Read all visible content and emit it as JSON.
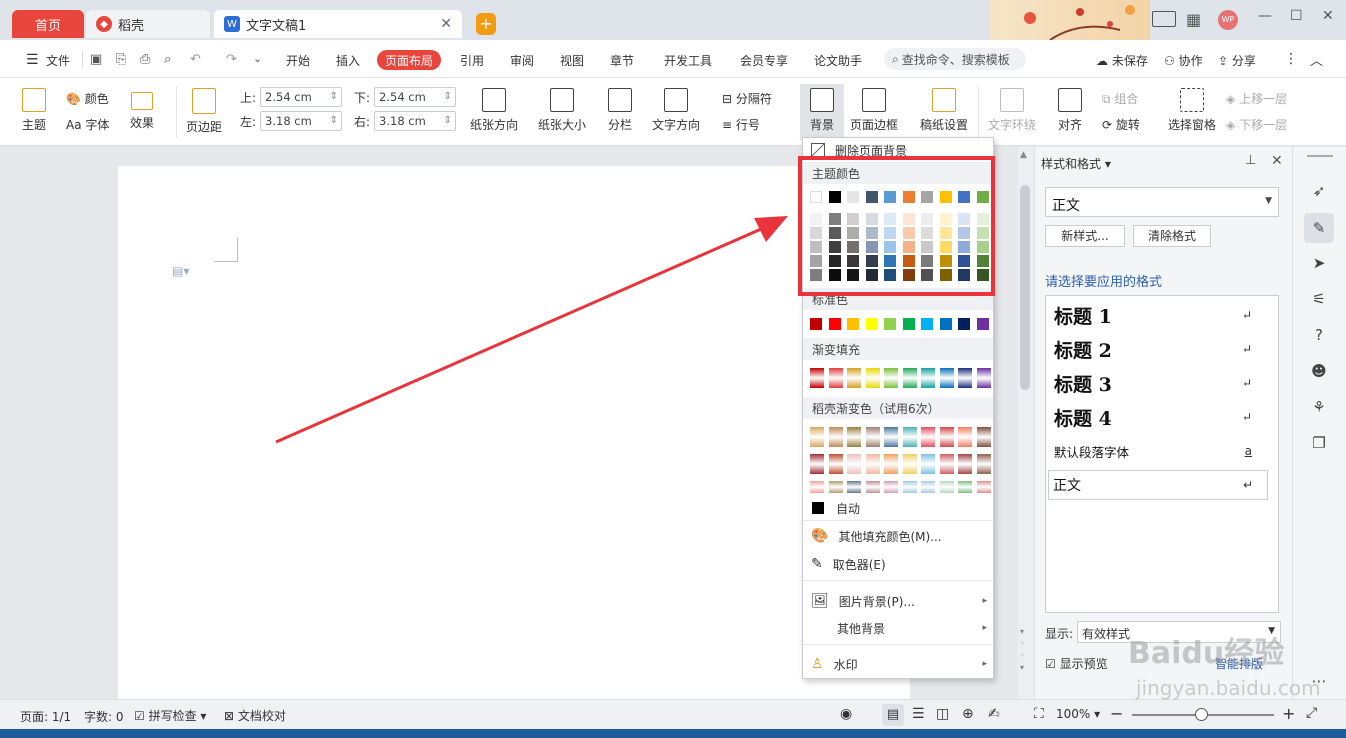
{
  "tabs": {
    "home": "首页",
    "daoke": "稻壳",
    "doc": "文字文稿1"
  },
  "menu": {
    "file": "文件",
    "items": [
      "开始",
      "插入",
      "页面布局",
      "引用",
      "审阅",
      "视图",
      "章节",
      "开发工具",
      "会员专享",
      "论文助手"
    ],
    "active_index": 2,
    "search": "查找命令、搜索模板",
    "unsaved": "未保存",
    "collab": "协作",
    "share": "分享"
  },
  "ribbon": {
    "theme": "主题",
    "color": "颜色",
    "font": "字体",
    "effect": "效果",
    "margins": "页边距",
    "top_label": "上:",
    "top_val": "2.54 cm",
    "bottom_label": "下:",
    "bottom_val": "2.54 cm",
    "left_label": "左:",
    "left_val": "3.18 cm",
    "right_label": "右:",
    "right_val": "3.18 cm",
    "orientation": "纸张方向",
    "size": "纸张大小",
    "columns": "分栏",
    "textdir": "文字方向",
    "breaks": "分隔符",
    "linenum": "行号",
    "background": "背景",
    "border": "页面边框",
    "grid": "稿纸设置",
    "wrap": "文字环绕",
    "align": "对齐",
    "group": "组合",
    "rotate": "旋转",
    "selpane": "选择窗格",
    "up": "上移一层",
    "down": "下移一层"
  },
  "dropdown": {
    "remove_bg": "删除页面背景",
    "theme_colors": "主题颜色",
    "std_colors": "标准色",
    "gradient": "渐变填充",
    "daoke_gradient": "稻壳渐变色（试用6次）",
    "auto": "自动",
    "more_colors": "其他填充颜色(M)...",
    "picker": "取色器(E)",
    "pic_bg": "图片背景(P)...",
    "other_bg": "其他背景",
    "watermark": "水印"
  },
  "colors": {
    "theme_row": [
      "#ffffff",
      "#000000",
      "#e7e6e6",
      "#44546a",
      "#5b9bd5",
      "#ed7d31",
      "#a5a5a5",
      "#ffc000",
      "#4472c4",
      "#70ad47"
    ],
    "theme_shades": [
      [
        "#f2f2f2",
        "#7f7f7f",
        "#d0cece",
        "#d6dce4",
        "#deebf6",
        "#fbe5d5",
        "#ededed",
        "#fff2cc",
        "#dae3f3",
        "#e2efd9"
      ],
      [
        "#d8d8d8",
        "#595959",
        "#aeabab",
        "#adb9ca",
        "#bdd7ee",
        "#f7cbac",
        "#dbdbdb",
        "#fee599",
        "#b4c6e7",
        "#c5e0b3"
      ],
      [
        "#bfbfbf",
        "#3f3f3f",
        "#757070",
        "#8496b0",
        "#9dc3e6",
        "#f4b183",
        "#c9c9c9",
        "#ffd966",
        "#8eaadb",
        "#a8d08d"
      ],
      [
        "#a5a5a5",
        "#262626",
        "#3a3838",
        "#323f4f",
        "#2e75b5",
        "#c55a11",
        "#7b7b7b",
        "#bf9000",
        "#2f5496",
        "#538135"
      ],
      [
        "#7f7f7f",
        "#0c0c0c",
        "#171616",
        "#222a35",
        "#1e4e79",
        "#833c0b",
        "#525252",
        "#7f6000",
        "#1f3864",
        "#375623"
      ]
    ],
    "standard": [
      "#c00000",
      "#ff0000",
      "#ffc000",
      "#ffff00",
      "#92d050",
      "#00b050",
      "#00b0f0",
      "#0070c0",
      "#002060",
      "#7030a0"
    ],
    "gradient": [
      "#c00000",
      "#e03c3c",
      "#d4a020",
      "#e6d800",
      "#7cbf3a",
      "#1fa85a",
      "#14a0a0",
      "#0a70b8",
      "#1a2f7a",
      "#6a2fa0"
    ],
    "daoke1": [
      "#d9a860",
      "#c08a58",
      "#9a8040",
      "#a08070",
      "#4a78a0",
      "#4ab0b8",
      "#e05060",
      "#d04848",
      "#f08060",
      "#805040"
    ],
    "daoke2": [
      "#a03038",
      "#c05030",
      "#f0c0c0",
      "#f0b8a0",
      "#f0a060",
      "#f0d060",
      "#80c0e0",
      "#d06060",
      "#a04848",
      "#906050"
    ],
    "daoke3": [
      "#f0a0a0",
      "#b0a070",
      "#607890",
      "#c09090",
      "#d0a0b0",
      "#a0c8e8",
      "#a8c8e0",
      "#b8d8c0",
      "#80c080",
      "#e09090"
    ]
  },
  "panel": {
    "title": "样式和格式",
    "current": "正文",
    "new_style": "新样式...",
    "clear": "清除格式",
    "prompt": "请选择要应用的格式",
    "styles": [
      "标题 1",
      "标题 2",
      "标题 3",
      "标题 4",
      "默认段落字体",
      "正文"
    ],
    "show_label": "显示:",
    "show_val": "有效样式",
    "preview": "显示预览",
    "smart": "智能排版"
  },
  "status": {
    "page": "页面: 1/1",
    "words": "字数: 0",
    "spell": "拼写检查",
    "proof": "文档校对",
    "zoom": "100%"
  },
  "watermark_text": "Baidu经验",
  "watermark_url": "jingyan.baidu.com"
}
